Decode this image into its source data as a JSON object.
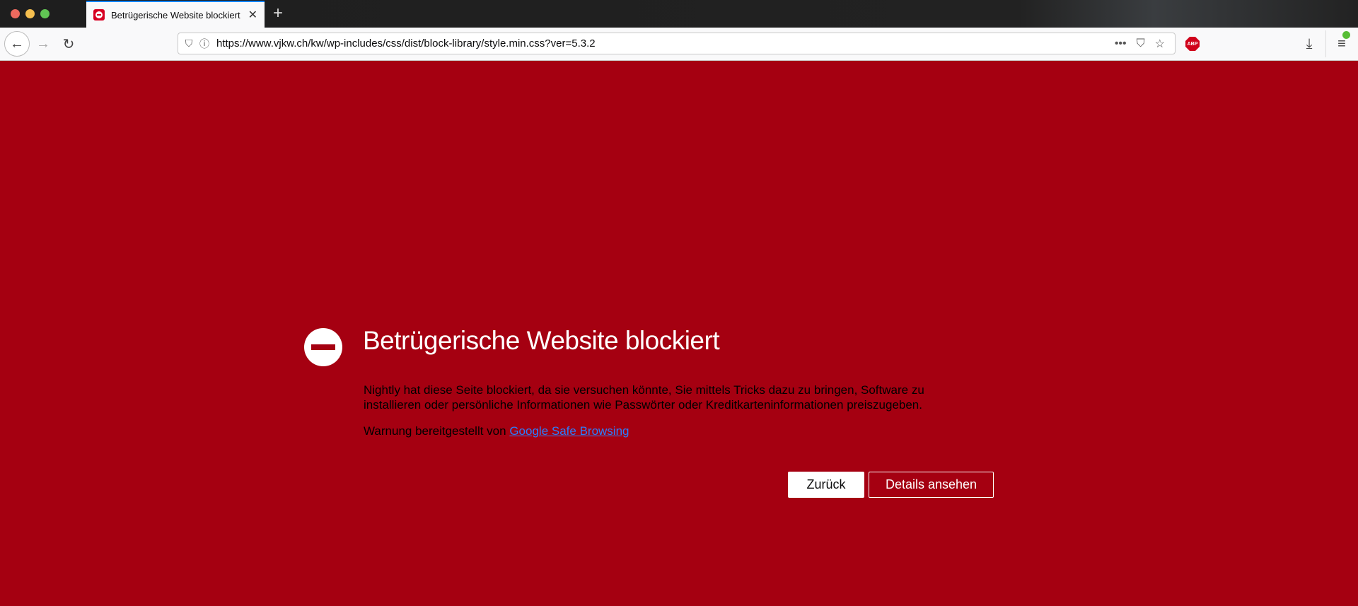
{
  "tab": {
    "title": "Betrügerische Website blockiert",
    "close": "✕",
    "new_tab": "+"
  },
  "toolbar": {
    "back": "←",
    "forward": "→",
    "reload": "↻",
    "url": "https://www.vjkw.ch/kw/wp-includes/css/dist/block-library/style.min.css?ver=5.3.2",
    "more": "•••",
    "abp": "ABP",
    "download": "⤓",
    "menu": "≡"
  },
  "page": {
    "title": "Betrügerische Website blockiert",
    "body": "Nightly hat diese Seite blockiert, da sie versuchen könnte, Sie mittels Tricks dazu zu bringen, Software zu installieren oder persönliche Informationen wie Passwörter oder Kreditkarteninformationen preiszugeben.",
    "warning_prefix": "Warnung bereitgestellt von ",
    "warning_link": "Google Safe Browsing",
    "back_button": "Zurück",
    "details_button": "Details ansehen"
  },
  "colors": {
    "background": "#a50011",
    "link": "#2a7fff"
  }
}
